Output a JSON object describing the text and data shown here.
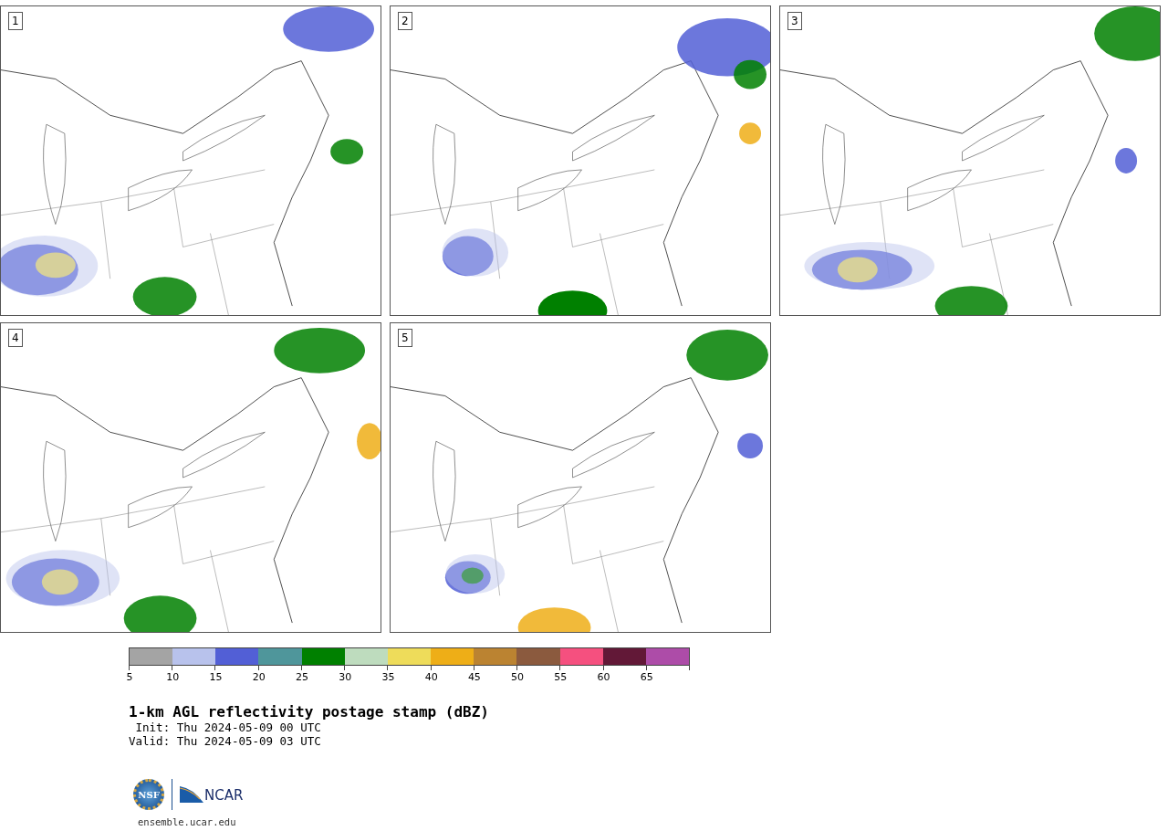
{
  "panels": [
    {
      "number": "1"
    },
    {
      "number": "2"
    },
    {
      "number": "3"
    },
    {
      "number": "4"
    },
    {
      "number": "5"
    }
  ],
  "colorbar": {
    "segments": [
      {
        "color": "#a4a4a4",
        "label": "5"
      },
      {
        "color": "#b8c2ec",
        "label": "10"
      },
      {
        "color": "#525fd6",
        "label": "15"
      },
      {
        "color": "#4f969b",
        "label": "20"
      },
      {
        "color": "#008000",
        "label": "25"
      },
      {
        "color": "#bedcbe",
        "label": "30"
      },
      {
        "color": "#eedc5a",
        "label": "35"
      },
      {
        "color": "#eeae17",
        "label": "40"
      },
      {
        "color": "#bb8331",
        "label": "45"
      },
      {
        "color": "#8b5a3e",
        "label": "50"
      },
      {
        "color": "#f5507f",
        "label": "55"
      },
      {
        "color": "#621837",
        "label": "60"
      },
      {
        "color": "#ad4ca8",
        "label": "65"
      }
    ]
  },
  "title": "1-km AGL reflectivity postage stamp (dBZ)",
  "init": " Init: Thu 2024-05-09 00 UTC",
  "valid": "Valid: Thu 2024-05-09 03 UTC",
  "logos": {
    "left": "NSF",
    "right": "NCAR"
  },
  "site": "ensemble.ucar.edu"
}
